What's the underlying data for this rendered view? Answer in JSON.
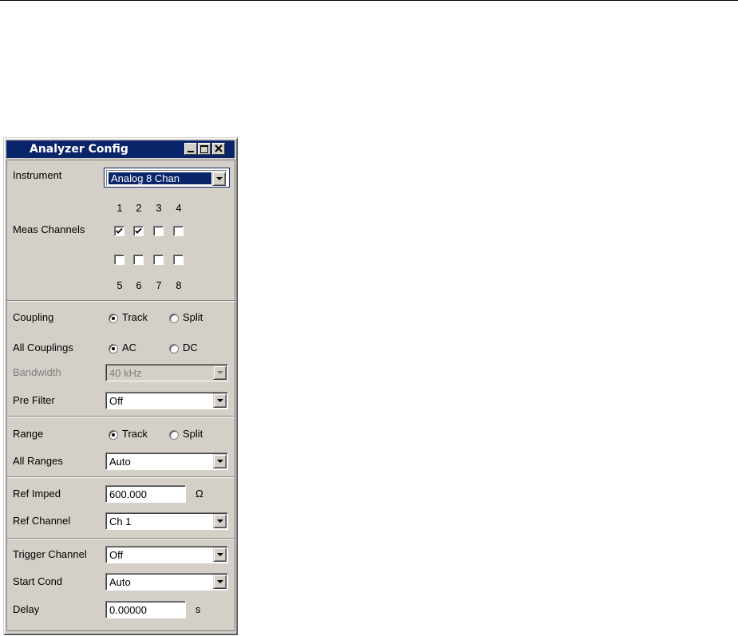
{
  "window": {
    "title": "Analyzer Config"
  },
  "instrument": {
    "label": "Instrument",
    "value": "Analog  8 Chan"
  },
  "meas_channels": {
    "label": "Meas Channels",
    "top_numbers": [
      "1",
      "2",
      "3",
      "4"
    ],
    "bottom_numbers": [
      "5",
      "6",
      "7",
      "8"
    ],
    "checked": [
      true,
      true,
      false,
      false,
      false,
      false,
      false,
      false
    ]
  },
  "coupling": {
    "label": "Coupling",
    "options": [
      "Track",
      "Split"
    ],
    "selected": "Track"
  },
  "all_couplings": {
    "label": "All Couplings",
    "options": [
      "AC",
      "DC"
    ],
    "selected": "AC"
  },
  "bandwidth": {
    "label": "Bandwidth",
    "value": "40 kHz",
    "enabled": false
  },
  "pre_filter": {
    "label": "Pre Filter",
    "value": "Off"
  },
  "range": {
    "label": "Range",
    "options": [
      "Track",
      "Split"
    ],
    "selected": "Track"
  },
  "all_ranges": {
    "label": "All Ranges",
    "value": "Auto"
  },
  "ref_imped": {
    "label": "Ref Imped",
    "value": "600.000",
    "unit": "Ω"
  },
  "ref_channel": {
    "label": "Ref Channel",
    "value": "Ch 1"
  },
  "trigger_channel": {
    "label": "Trigger Channel",
    "value": "Off"
  },
  "start_cond": {
    "label": "Start Cond",
    "value": "Auto"
  },
  "delay": {
    "label": "Delay",
    "value": "0.00000",
    "unit": "s"
  },
  "colors": {
    "titlebar": "#0a246a",
    "face": "#d4d0c8"
  }
}
